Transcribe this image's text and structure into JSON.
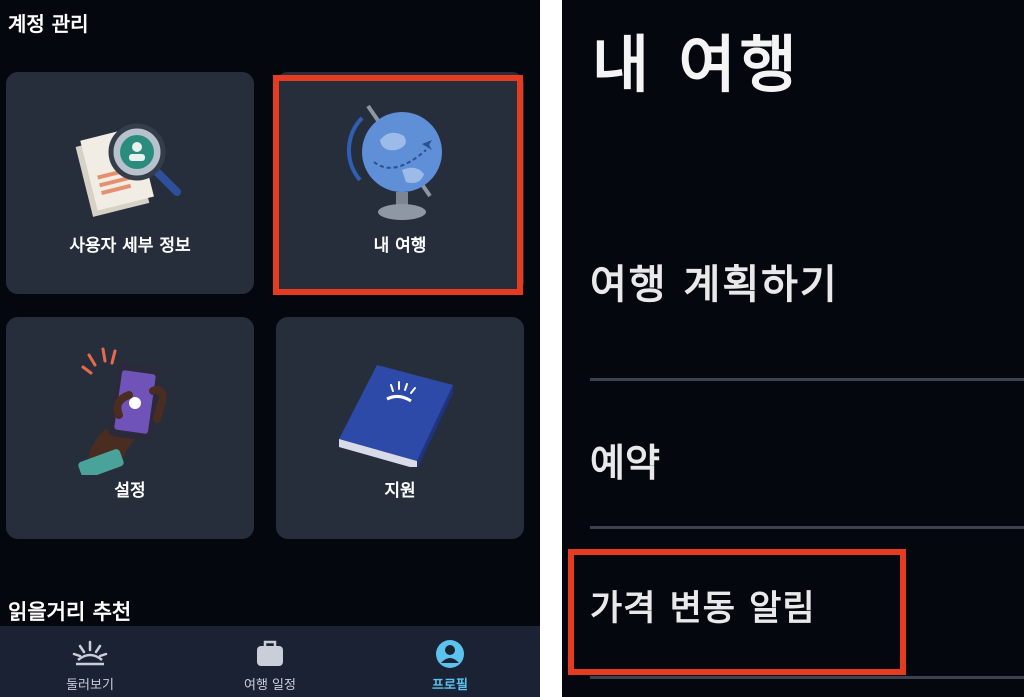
{
  "left_screen": {
    "section_title": "계정 관리",
    "cards": [
      {
        "label": "사용자 세부 정보",
        "icon": "magnifier-document-icon"
      },
      {
        "label": "내 여행",
        "icon": "globe-icon"
      },
      {
        "label": "설정",
        "icon": "phone-in-hand-icon"
      },
      {
        "label": "지원",
        "icon": "book-icon"
      }
    ],
    "reading_title": "읽을거리 추천",
    "tabs": [
      {
        "label": "둘러보기",
        "icon": "sunrise-icon"
      },
      {
        "label": "여행 일정",
        "icon": "suitcase-icon"
      },
      {
        "label": "프로필",
        "icon": "profile-icon",
        "active": true
      }
    ]
  },
  "right_screen": {
    "title": "내 여행",
    "menu": [
      {
        "label": "여행 계획하기"
      },
      {
        "label": "예약"
      },
      {
        "label": "가격 변동 알림"
      }
    ]
  },
  "colors": {
    "background": "#05070f",
    "card": "#262e3c",
    "highlight": "#e53b20",
    "active_tab": "#5bc3ee"
  }
}
